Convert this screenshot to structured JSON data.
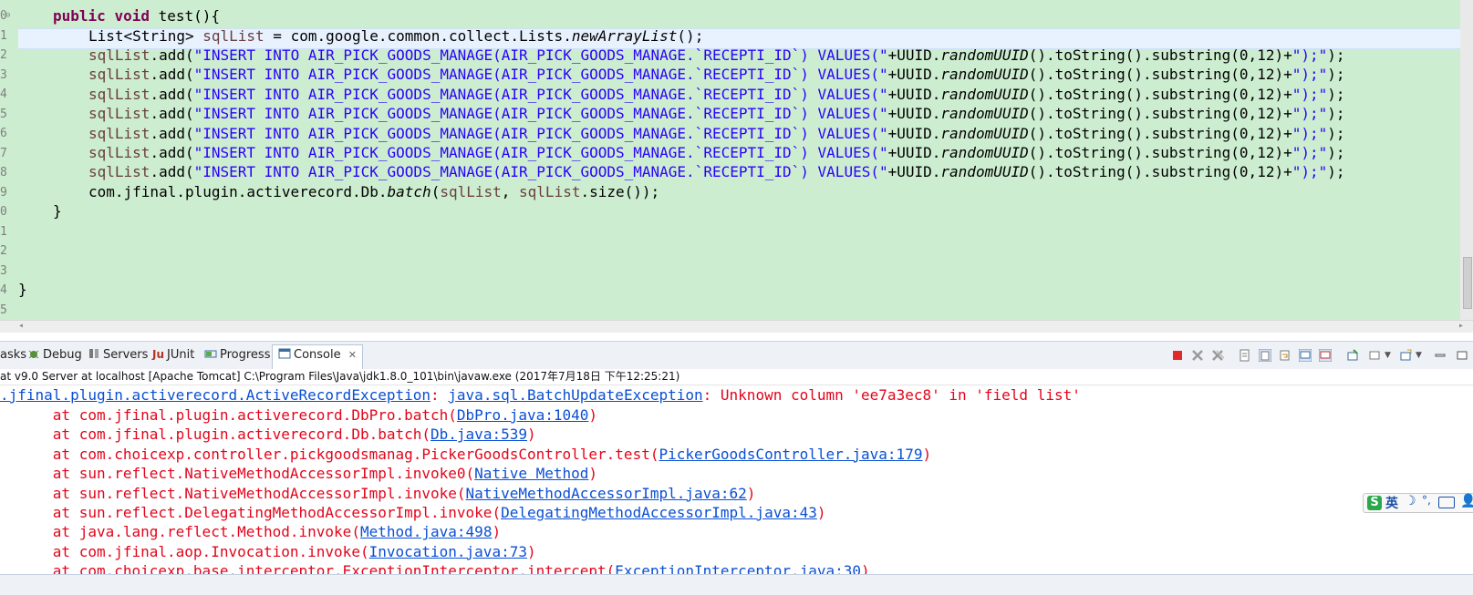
{
  "editor": {
    "gutter": [
      "0",
      "1",
      "2",
      "3",
      "4",
      "5",
      "6",
      "7",
      "8",
      "9",
      "0",
      "1",
      "2",
      "3",
      "4",
      "5"
    ],
    "line0": {
      "kw1": "public",
      "kw2": "void",
      "rest": " test(){"
    },
    "line1": {
      "a": "List<String> ",
      "fld": "sqlList",
      "b": " = com.google.common.collect.Lists.",
      "it": "newArrayList",
      "c": "();"
    },
    "add_line": {
      "fld": "sqlList",
      "a": ".add(",
      "str1": "\"INSERT INTO AIR_PICK_GOODS_MANAGE(AIR_PICK_GOODS_MANAGE.`RECEPTI_ID`) VALUES(\"",
      "b": "+UUID.",
      "it": "randomUUID",
      "c": "().toString().substring(0,12)+",
      "str2": "\");\"",
      "d": ");"
    },
    "line9": {
      "a": "com.jfinal.plugin.activerecord.Db.",
      "it": "batch",
      "b": "(",
      "fld1": "sqlList",
      "c": ", ",
      "fld2": "sqlList",
      "d": ".size());"
    },
    "line10": "}",
    "line14": "}"
  },
  "views": {
    "tabs": [
      {
        "label": "asks",
        "icon": "tasks-icon"
      },
      {
        "label": "Debug",
        "icon": "debug-icon"
      },
      {
        "label": "Servers",
        "icon": "servers-icon"
      },
      {
        "label": "JUnit",
        "icon": "junit-icon"
      },
      {
        "label": "Progress",
        "icon": "progress-icon"
      },
      {
        "label": "Console",
        "icon": "console-icon"
      }
    ],
    "close_glyph": "✕"
  },
  "status_line": "at v9.0 Server at localhost [Apache Tomcat] C:\\Program Files\\Java\\jdk1.8.0_101\\bin\\javaw.exe (2017年7月18日 下午12:25:21)",
  "console": {
    "first": {
      "ex1": ".jfinal.plugin.activerecord.ActiveRecordException",
      "sep": ": ",
      "ex2": "java.sql.BatchUpdateException",
      "msg": ": Unknown column 'ee7a3ec8' in 'field list'"
    },
    "frames": [
      {
        "text": "\tat com.jfinal.plugin.activerecord.DbPro.batch(",
        "link": "DbPro.java:1040",
        "end": ")"
      },
      {
        "text": "\tat com.jfinal.plugin.activerecord.Db.batch(",
        "link": "Db.java:539",
        "end": ")"
      },
      {
        "text": "\tat com.choicexp.controller.pickgoodsmanag.PickerGoodsController.test(",
        "link": "PickerGoodsController.java:179",
        "end": ")"
      },
      {
        "text": "\tat sun.reflect.NativeMethodAccessorImpl.invoke0(",
        "link": "Native Method",
        "end": ")"
      },
      {
        "text": "\tat sun.reflect.NativeMethodAccessorImpl.invoke(",
        "link": "NativeMethodAccessorImpl.java:62",
        "end": ")"
      },
      {
        "text": "\tat sun.reflect.DelegatingMethodAccessorImpl.invoke(",
        "link": "DelegatingMethodAccessorImpl.java:43",
        "end": ")"
      },
      {
        "text": "\tat java.lang.reflect.Method.invoke(",
        "link": "Method.java:498",
        "end": ")"
      },
      {
        "text": "\tat com.jfinal.aop.Invocation.invoke(",
        "link": "Invocation.java:73",
        "end": ")"
      },
      {
        "text": "\tat com.choicexp.base.interceptor.ExceptionInterceptor.intercept(",
        "link": "ExceptionInterceptor.java:30",
        "end": ")"
      }
    ]
  },
  "ime": {
    "logo": "S",
    "lang": "英",
    "moon": "☽",
    "punct": "°,",
    "user": "👤"
  },
  "colors": {
    "editor_bg": "#cdedd0",
    "error_red": "#e3051b",
    "link_blue": "#0a4fd4",
    "keyword": "#7f0055",
    "field": "#6a3e3e",
    "string": "#2a00ff"
  }
}
